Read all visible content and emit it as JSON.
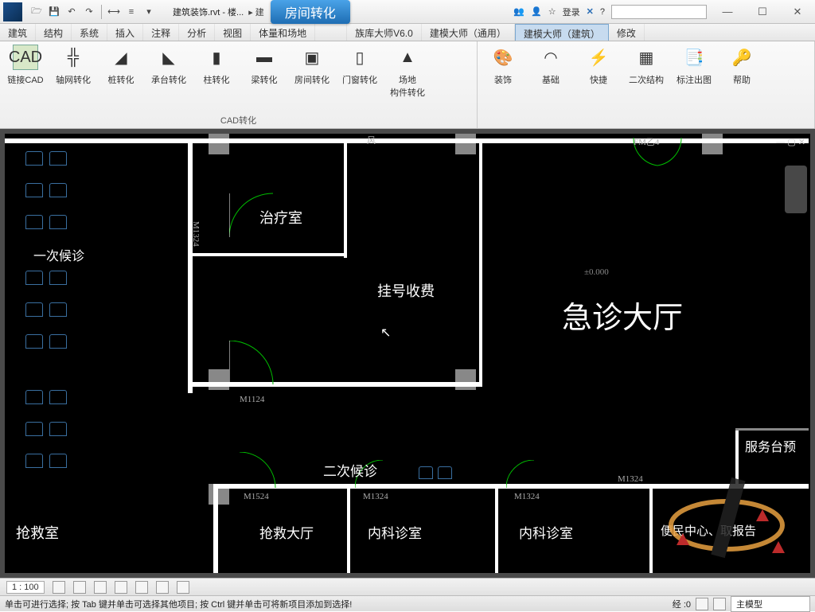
{
  "title": {
    "doc": "建筑装饰.rvt - 楼...",
    "highlight": "房间转化"
  },
  "titlebar_right": {
    "star": "☆",
    "login": "登录",
    "help": "?"
  },
  "menutabs": [
    "建筑",
    "结构",
    "系统",
    "插入",
    "注释",
    "分析",
    "视图",
    "体量和场地",
    "",
    "族库大师V6.0",
    "建模大师（通用）",
    "建模大师（建筑）",
    "修改"
  ],
  "active_tab_index": 11,
  "ribbon": {
    "group1": {
      "label": "CAD转化",
      "items": [
        {
          "label": "链接CAD"
        },
        {
          "label": "轴网转化"
        },
        {
          "label": "桩转化"
        },
        {
          "label": "承台转化"
        },
        {
          "label": "柱转化"
        },
        {
          "label": "梁转化"
        },
        {
          "label": "房间转化"
        },
        {
          "label": "门窗转化"
        },
        {
          "label": "场地\n构件转化"
        }
      ]
    },
    "group2": {
      "items": [
        {
          "label": "装饰"
        },
        {
          "label": "基础"
        },
        {
          "label": "快捷"
        },
        {
          "label": "二次结构"
        },
        {
          "label": "标注出图"
        },
        {
          "label": "帮助"
        }
      ]
    }
  },
  "rooms": {
    "r1": "一次候诊",
    "r2": "治疗室",
    "r3": "挂号收费",
    "r4": "急诊大厅",
    "r5": "二次候诊",
    "r6": "抢救室",
    "r7": "抢救大厅",
    "r8": "内科诊室",
    "r9": "内科诊室",
    "r10": "便民中心、取报告",
    "r11": "服务台预"
  },
  "doors": {
    "d1": "M1324",
    "d2": "M1124",
    "d3": "M1524",
    "d4": "M1324",
    "d5": "M1324",
    "d6": "M1324",
    "d7": "FM乙4",
    "d8": "风"
  },
  "elev": "±0.000",
  "status": {
    "scale": "1 : 100",
    "hint": "单击可进行选择; 按 Tab 键并单击可选择其他项目; 按 Ctrl 键并单击可将新项目添加到选择!",
    "coord": "经 :0",
    "model": "主模型"
  }
}
